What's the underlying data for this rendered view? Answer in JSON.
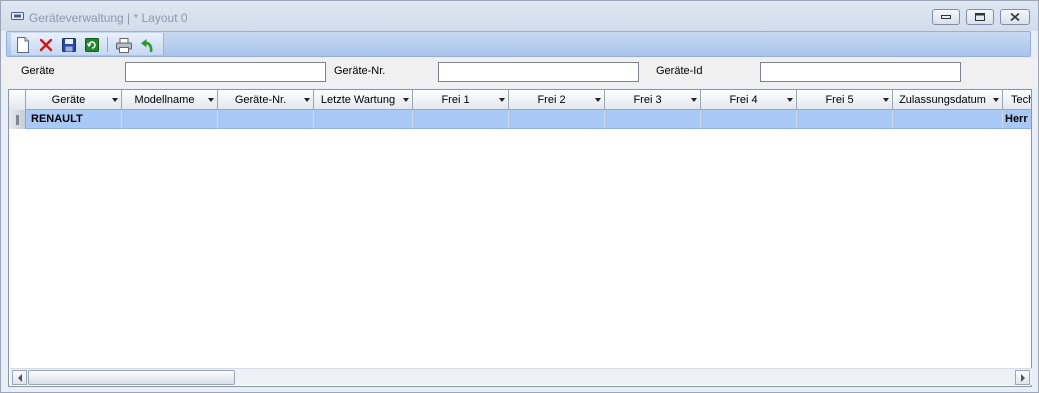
{
  "window": {
    "title": "Geräteverwaltung | * Layout 0",
    "controls": {
      "minimize": "minimize-icon",
      "maximize": "maximize-icon",
      "close": "close-icon"
    }
  },
  "toolbar": {
    "buttons": [
      {
        "name": "new",
        "icon": "new-document-icon"
      },
      {
        "name": "delete",
        "icon": "delete-x-icon",
        "color": "#d01818"
      },
      {
        "name": "save",
        "icon": "floppy-disk-icon",
        "color": "#2a48a8"
      },
      {
        "name": "refresh",
        "icon": "refresh-icon",
        "color": "#1e8a2a"
      },
      {
        "name": "print",
        "icon": "printer-icon"
      },
      {
        "name": "undo",
        "icon": "undo-arrow-icon",
        "color": "#2a9a2a"
      }
    ]
  },
  "filters": {
    "geraete_label": "Geräte",
    "geraete_value": "",
    "geraete_nr_label": "Geräte-Nr.",
    "geraete_nr_value": "",
    "geraete_id_label": "Geräte-Id",
    "geraete_id_value": ""
  },
  "grid": {
    "columns": [
      "Geräte",
      "Modellname",
      "Geräte-Nr.",
      "Letzte Wartung",
      "Frei 1",
      "Frei 2",
      "Frei 3",
      "Frei 4",
      "Frei 5",
      "Zulassungsdatum",
      "Tech"
    ],
    "rows": [
      [
        "RENAULT",
        "",
        "",
        "",
        "",
        "",
        "",
        "",
        "",
        "",
        "Herr"
      ]
    ],
    "selected_row_color": "#a8c8f6"
  }
}
